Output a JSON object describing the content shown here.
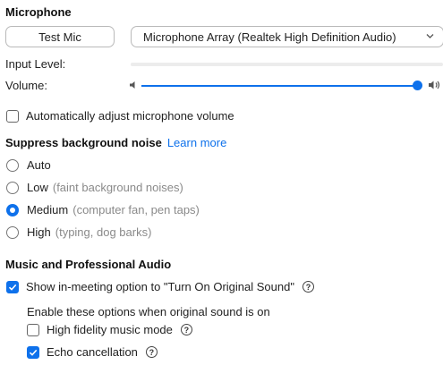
{
  "microphone": {
    "title": "Microphone",
    "test_button": "Test Mic",
    "device_select": "Microphone Array (Realtek High Definition Audio)",
    "input_level_label": "Input Level:",
    "volume_label": "Volume:",
    "volume_level": 1.0
  },
  "auto_adjust": {
    "label": "Automatically adjust microphone volume",
    "checked": false
  },
  "suppress": {
    "title": "Suppress background noise",
    "learn_more": "Learn more",
    "options": [
      {
        "label": "Auto",
        "hint": ""
      },
      {
        "label": "Low",
        "hint": "(faint background noises)"
      },
      {
        "label": "Medium",
        "hint": "(computer fan, pen taps)"
      },
      {
        "label": "High",
        "hint": "(typing, dog barks)"
      }
    ],
    "selected": "Medium"
  },
  "music": {
    "title": "Music and Professional Audio",
    "show_option_label": "Show in-meeting option to \"Turn On Original Sound\"",
    "enable_text": "Enable these options when original sound is on",
    "high_fidelity_label": "High fidelity music mode",
    "echo_label": "Echo cancellation",
    "help_glyph": "?"
  },
  "colors": {
    "accent": "#0e71eb",
    "muted": "#8a8a8a"
  }
}
